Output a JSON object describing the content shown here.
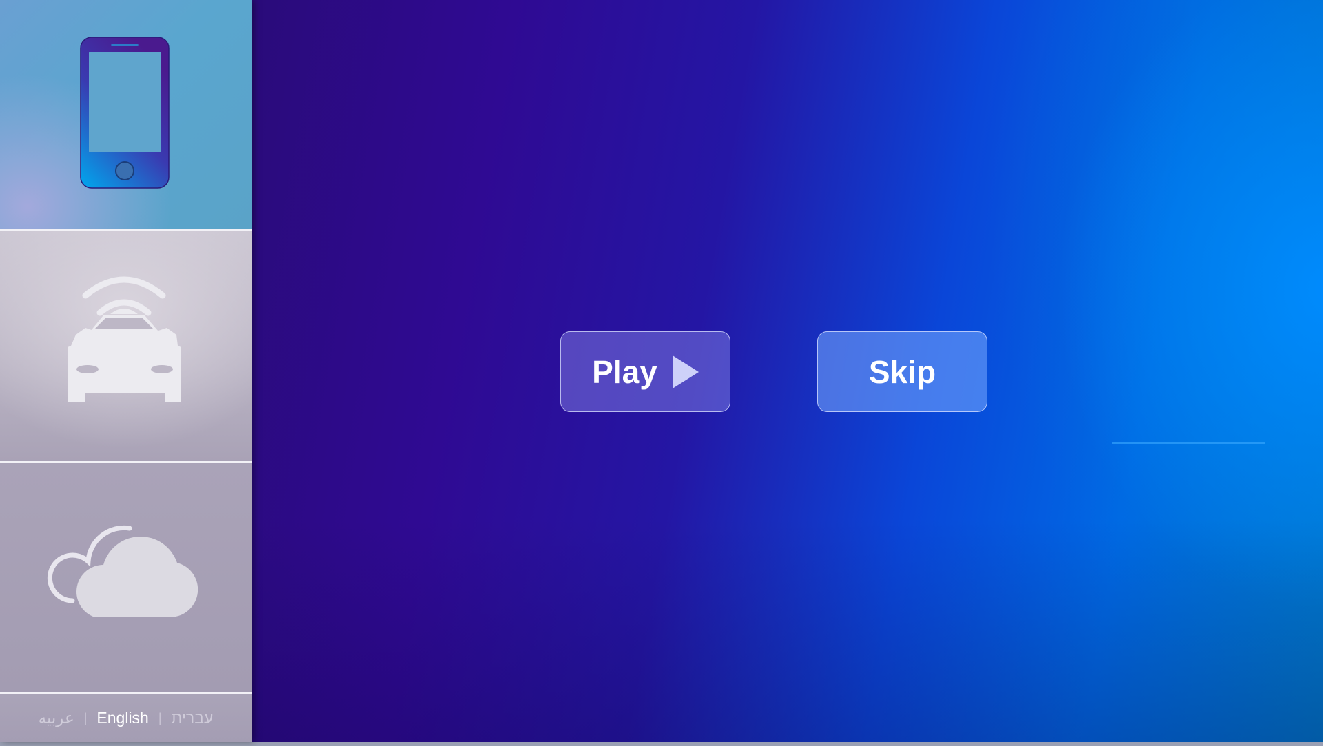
{
  "sidebar": {
    "tiles": [
      {
        "icon": "smartphone-icon"
      },
      {
        "icon": "connected-car-icon"
      },
      {
        "icon": "cloud-icon"
      }
    ],
    "languages": {
      "arabic": "عربيه",
      "english": "English",
      "hebrew": "עברית",
      "separator": "|",
      "selected": "English"
    }
  },
  "main": {
    "play_label": "Play",
    "skip_label": "Skip"
  },
  "colors": {
    "background_start": "#2f0a93",
    "background_end": "#0079c8",
    "accent": "#008cff"
  }
}
